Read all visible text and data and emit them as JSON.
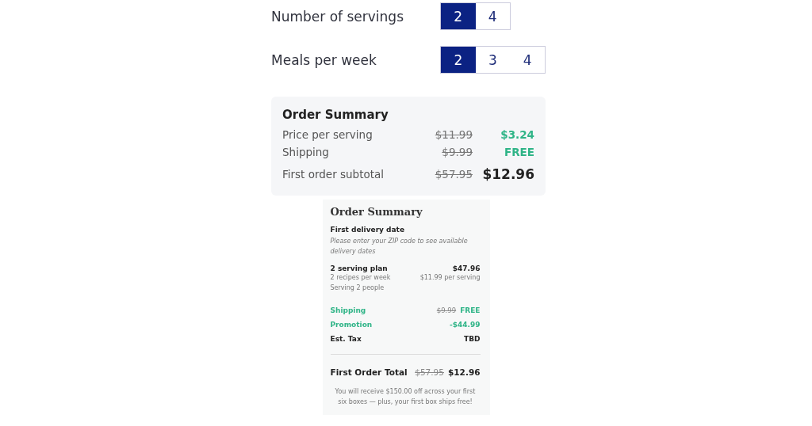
{
  "options": [
    {
      "label": "Number of servings",
      "choices": [
        {
          "label": "2",
          "selected": true
        },
        {
          "label": "4",
          "selected": false
        }
      ]
    },
    {
      "label": "Meals per week",
      "choices": [
        {
          "label": "2",
          "selected": true
        },
        {
          "label": "3",
          "selected": false
        },
        {
          "label": "4",
          "selected": false
        }
      ]
    }
  ],
  "summary": {
    "title": "Order Summary",
    "rows": [
      {
        "label": "Price per serving",
        "old": "$11.99",
        "new": "$3.24",
        "kind": "accent"
      },
      {
        "label": "Shipping",
        "old": "$9.99",
        "new": "FREE",
        "kind": "accent"
      },
      {
        "label": "First order subtotal",
        "old": "$57.95",
        "new": "$12.96",
        "kind": "total"
      }
    ]
  },
  "detail": {
    "title": "Order Summary",
    "delivery_label": "First delivery date",
    "delivery_note": "Please enter your ZIP code to see available delivery dates",
    "plan": {
      "name": "2 serving plan",
      "price": "$47.96",
      "line_1": "2 recipes per week",
      "per_serving": "$11.99 per serving",
      "line_2": "Serving 2 people"
    },
    "lines": [
      {
        "label": "Shipping",
        "old": "$9.99",
        "value": "FREE",
        "kind": "accent"
      },
      {
        "label": "Promotion",
        "value": "-$44.99",
        "kind": "accent"
      },
      {
        "label": "Est. Tax",
        "value": "TBD",
        "kind": "plain"
      }
    ],
    "total": {
      "label": "First Order Total",
      "old": "$57.95",
      "value": "$12.96"
    },
    "note": "You will receive $150.00 off across your first six boxes — plus, your first box ships free!"
  }
}
